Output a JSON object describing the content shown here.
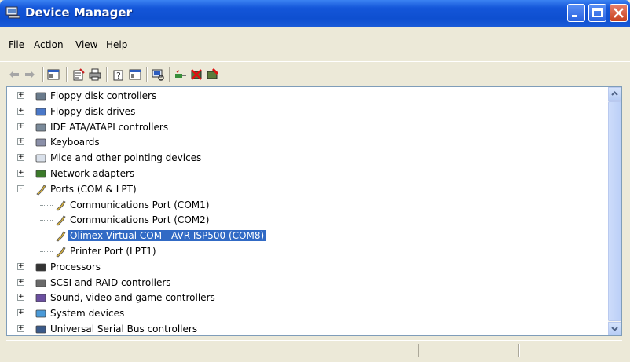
{
  "window": {
    "title": "Device Manager"
  },
  "menu": [
    "File",
    "Action",
    "View",
    "Help"
  ],
  "toolbar": {
    "buttons": [
      "back-arrow-icon",
      "forward-arrow-icon",
      "show-hide-console-tree-icon",
      "properties-icon",
      "print-icon",
      "help-icon",
      "view-icon",
      "scan-hardware-icon",
      "update-driver-icon",
      "disable-device-icon",
      "uninstall-device-icon"
    ]
  },
  "tree": [
    {
      "label": "Floppy disk controllers",
      "icon": "floppy-controller-icon",
      "level": 0,
      "expander": "+"
    },
    {
      "label": "Floppy disk drives",
      "icon": "floppy-drive-icon",
      "level": 0,
      "expander": "+"
    },
    {
      "label": "IDE ATA/ATAPI controllers",
      "icon": "ide-controller-icon",
      "level": 0,
      "expander": "+"
    },
    {
      "label": "Keyboards",
      "icon": "keyboard-icon",
      "level": 0,
      "expander": "+"
    },
    {
      "label": "Mice and other pointing devices",
      "icon": "mouse-icon",
      "level": 0,
      "expander": "+"
    },
    {
      "label": "Network adapters",
      "icon": "network-adapter-icon",
      "level": 0,
      "expander": "+"
    },
    {
      "label": "Ports (COM & LPT)",
      "icon": "port-icon",
      "level": 0,
      "expander": "-"
    },
    {
      "label": "Communications Port (COM1)",
      "icon": "port-icon",
      "level": 1
    },
    {
      "label": "Communications Port (COM2)",
      "icon": "port-icon",
      "level": 1
    },
    {
      "label": "Olimex Virtual COM - AVR-ISP500 (COM8)",
      "icon": "port-icon",
      "level": 1,
      "selected": true
    },
    {
      "label": "Printer Port (LPT1)",
      "icon": "port-icon",
      "level": 1
    },
    {
      "label": "Processors",
      "icon": "processor-icon",
      "level": 0,
      "expander": "+"
    },
    {
      "label": "SCSI and RAID controllers",
      "icon": "scsi-controller-icon",
      "level": 0,
      "expander": "+"
    },
    {
      "label": "Sound, video and game controllers",
      "icon": "sound-icon",
      "level": 0,
      "expander": "+"
    },
    {
      "label": "System devices",
      "icon": "system-device-icon",
      "level": 0,
      "expander": "+"
    },
    {
      "label": "Universal Serial Bus controllers",
      "icon": "usb-icon",
      "level": 0,
      "expander": "+"
    }
  ],
  "colors": {
    "title_bar": "#0e4fd0",
    "selection": "#316ac5",
    "window_bg": "#ece9d8"
  }
}
